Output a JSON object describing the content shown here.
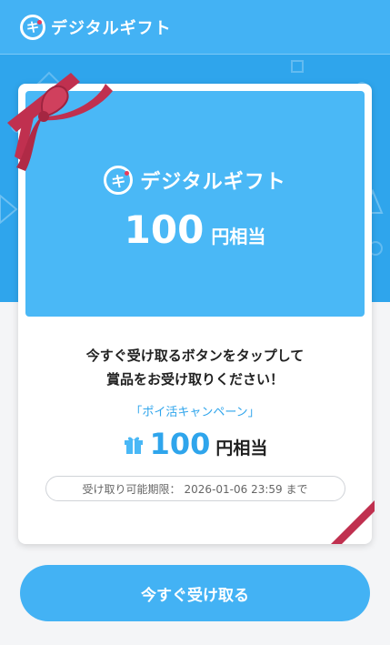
{
  "header": {
    "logo_mark": "キ",
    "logo_text": "デジタルギフト"
  },
  "card": {
    "hero": {
      "logo_mark": "キ",
      "logo_text": "デジタルギフト",
      "amount_number": "100",
      "amount_unit": "円相当"
    },
    "message_line1": "今すぐ受け取るボタンをタップして",
    "message_line2": "賞品をお受け取りください！",
    "campaign": "「ポイ活キャンペーン」",
    "amount_number": "100",
    "amount_unit": "円相当",
    "expiry_label": "受け取り可能期限：",
    "expiry_value": "2026-01-06 23:59 まで"
  },
  "cta": {
    "label": "今すぐ受け取る"
  },
  "colors": {
    "brand_blue": "#43b2f4",
    "accent_red": "#e63b5a",
    "ribbon": "#c0304f"
  },
  "icons": {
    "logo": "gift-brand-icon",
    "gift": "gift-box-icon"
  }
}
